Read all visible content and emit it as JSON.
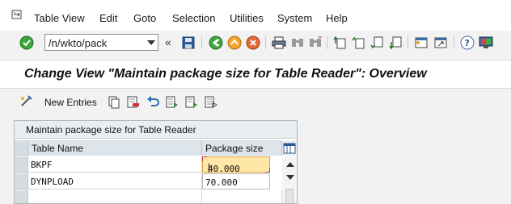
{
  "menubar": {
    "items": [
      "Table View",
      "Edit",
      "Goto",
      "Selection",
      "Utilities",
      "System",
      "Help"
    ]
  },
  "toolbar": {
    "command_field": "/n/wkto/pack",
    "icons": [
      "enter-icon",
      "save-icon",
      "back-icon",
      "exit-icon",
      "cancel-icon",
      "print-icon",
      "find-icon",
      "find-next-icon",
      "first-page-icon",
      "previous-page-icon",
      "next-page-icon",
      "last-page-icon",
      "create-session-icon",
      "shortcut-icon",
      "help-icon",
      "customize-layout-icon"
    ]
  },
  "title": "Change View \"Maintain package size for Table Reader\": Overview",
  "app_toolbar": {
    "new_entries_label": "New Entries"
  },
  "table": {
    "title": "Maintain package size for Table Reader",
    "columns": [
      "Table Name",
      "Package size"
    ],
    "rows": [
      {
        "table_name": "BKPF",
        "package_size": "40.000"
      },
      {
        "table_name": "DYNPLOAD",
        "package_size": "70.000"
      },
      {
        "table_name": "",
        "package_size": ""
      }
    ]
  },
  "colors": {
    "focus_cell": "#ffe7a8",
    "header_bg": "#dde4ea",
    "title_bg": "#ffffff"
  }
}
